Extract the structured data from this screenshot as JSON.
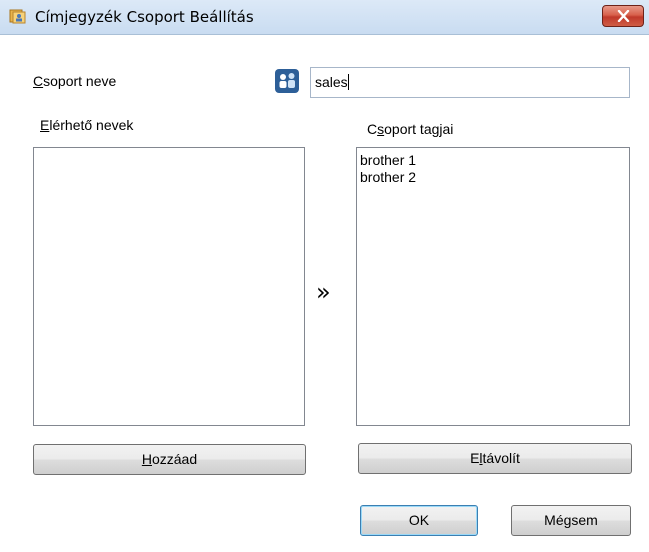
{
  "window": {
    "title": "Címjegyzék Csoport Beállítás",
    "close_label": "close"
  },
  "group_name": {
    "label_u": "C",
    "label_rest": "soport neve",
    "value": "sales"
  },
  "available": {
    "label_u": "E",
    "label_rest": "lérhető nevek",
    "items": []
  },
  "members": {
    "label_pre": "C",
    "label_u": "s",
    "label_mid": "oport tag",
    "label_u2": "j",
    "label_end": "ai",
    "items": [
      "brother 1",
      "brother 2"
    ]
  },
  "move_arrow": "»",
  "buttons": {
    "add_u": "H",
    "add_rest": "ozzáad",
    "remove_pre": "E",
    "remove_u": "l",
    "remove_rest": "távolít",
    "ok": "OK",
    "cancel": "Mégsem"
  }
}
